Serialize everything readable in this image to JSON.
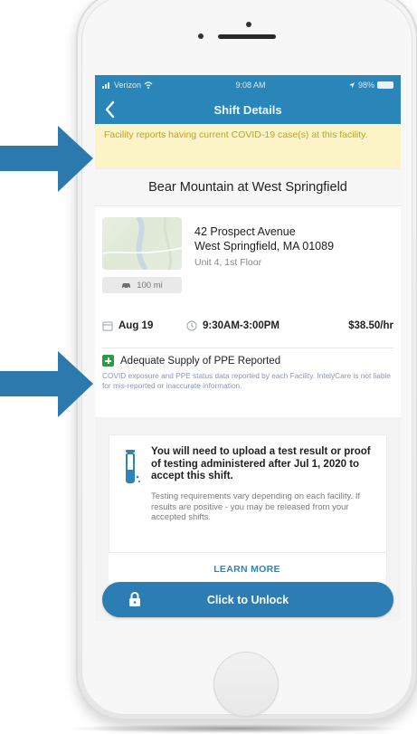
{
  "status_bar": {
    "carrier": "Verizon",
    "time": "9:08 AM",
    "battery": "98%"
  },
  "nav": {
    "title": "Shift Details"
  },
  "banner": {
    "text": "Facility reports having current COVID-19 case(s) at this facility."
  },
  "facility": {
    "name": "Bear Mountain at West Springfield"
  },
  "location": {
    "street": "42 Prospect Avenue",
    "city_state_zip": "West Springfield, MA 01089",
    "unit": "Unit 4, 1st Floor",
    "distance": "100 mi"
  },
  "shift": {
    "date": "Aug 19",
    "time": "9:30AM-3:00PM",
    "rate": "$38.50/hr"
  },
  "ppe": {
    "label": "Adequate Supply of PPE Reported",
    "note": "COVID exposure and PPE status data reported by each Facility. IntelyCare is not liable for mis-reported or inaccurate information."
  },
  "testing": {
    "title": "You will need to upload a test result or proof of testing administered after Jul 1, 2020 to accept this shift.",
    "body": "Testing requirements vary depending on each facility. If results are positive - you may be released from your accepted shifts.",
    "learn_more": "LEARN MORE"
  },
  "unlock": {
    "label": "Click to Unlock"
  },
  "colors": {
    "primary": "#2a86b9",
    "banner_bg": "#fcf4c6",
    "banner_text": "#bfa12e",
    "ppe_green": "#2f9a45",
    "arrow": "#2b79ad"
  }
}
